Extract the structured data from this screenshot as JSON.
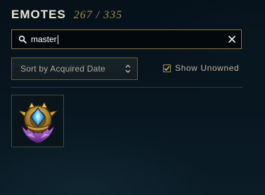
{
  "header": {
    "title": "EMOTES",
    "count": "267 / 335"
  },
  "search": {
    "value": "master",
    "icon": "search-icon",
    "clear_icon": "close-icon"
  },
  "sort": {
    "selected": "Sort by Acquired Date",
    "icon": "sort-arrows-icon"
  },
  "filters": {
    "show_unowned_label": "Show Unowned",
    "show_unowned_checked": true
  },
  "emotes": [
    {
      "icon": "master-crest-emote-icon",
      "owned": true
    }
  ],
  "colors": {
    "accent_gold": "#c8aa6e",
    "count_gold": "#a58a55",
    "title": "#ece4d2",
    "background": "#07121a"
  }
}
